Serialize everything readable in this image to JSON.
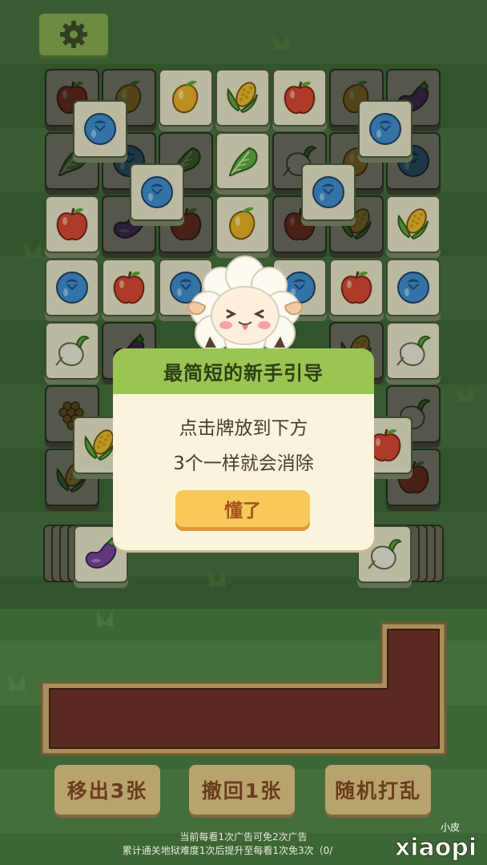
{
  "dialog": {
    "title": "最简短的新手引导",
    "line1": "点击牌放到下方",
    "line2": "3个一样就会消除",
    "confirm_label": "懂了"
  },
  "tools": {
    "remove_label": "移出3张",
    "undo_label": "撤回1张",
    "shuffle_label": "随机打乱"
  },
  "notes": {
    "line1": "当前每看1次广告可免2次广告",
    "line2": "累计通关地狱难度1次后提升至每看1次免3次（0/"
  },
  "watermark": {
    "top": "小皮",
    "main": "xiaopi"
  },
  "colors": {
    "background": "#446f3d",
    "dialog_header": "#9ac453",
    "button": "#f7c95a",
    "tray": "#5a2a20"
  }
}
